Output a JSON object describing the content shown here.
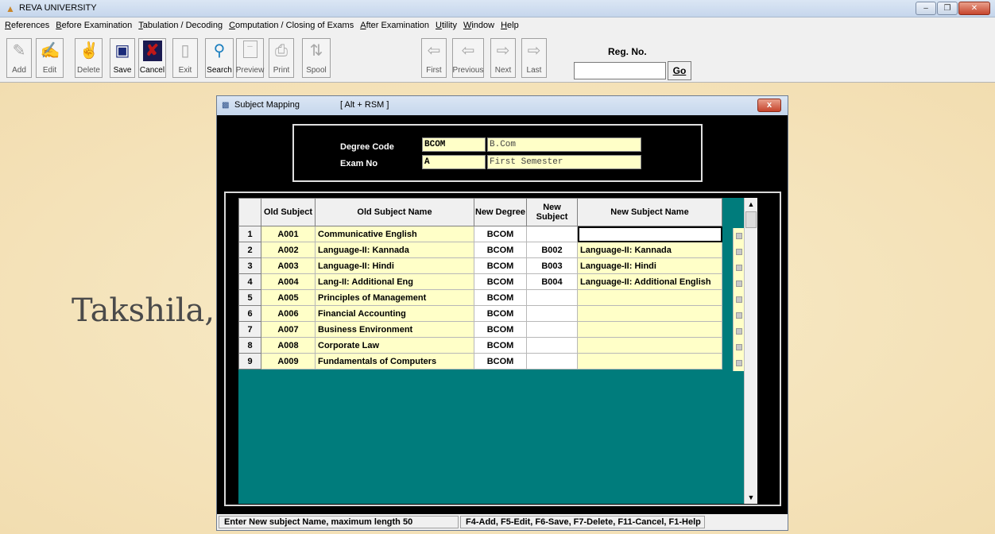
{
  "app": {
    "title": "REVA UNIVERSITY"
  },
  "menu": [
    "References",
    "Before Examination",
    "Tabulation / Decoding",
    "Computation / Closing of Exams",
    "After Examination",
    "Utility",
    "Window",
    "Help"
  ],
  "toolbar": {
    "buttons": [
      {
        "label": "Add",
        "icon": "add-record-icon"
      },
      {
        "label": "Edit",
        "icon": "edit-icon"
      },
      {
        "label": "Delete",
        "icon": "delete-icon"
      },
      {
        "label": "Save",
        "icon": "floppy-disk-icon"
      },
      {
        "label": "Cancel",
        "icon": "cancel-x-icon"
      },
      {
        "label": "Exit",
        "icon": "exit-door-icon"
      },
      {
        "label": "Search",
        "icon": "magnifier-icon"
      },
      {
        "label": "Preview",
        "icon": "document-preview-icon"
      },
      {
        "label": "Print",
        "icon": "printer-icon"
      },
      {
        "label": "Spool",
        "icon": "spool-icon"
      },
      {
        "label": "First",
        "icon": "first-arrow-icon"
      },
      {
        "label": "Previous",
        "icon": "previous-arrow-icon"
      },
      {
        "label": "Next",
        "icon": "next-arrow-icon"
      },
      {
        "label": "Last",
        "icon": "last-arrow-icon"
      }
    ],
    "reg_label": "Reg. No.",
    "reg_value": "",
    "go_label": "Go"
  },
  "backdrop": {
    "text": "Takshila, U"
  },
  "child": {
    "title": "Subject Mapping",
    "hotkey": "[ Alt + RSM ]",
    "close": "x",
    "degree_code_label": "Degree Code",
    "degree_code": "BCOM",
    "degree_name": "B.Com",
    "exam_no_label": "Exam No",
    "exam_no": "A",
    "exam_name": "First Semester"
  },
  "grid": {
    "headers": [
      "Old Subject",
      "Old Subject Name",
      "New Degree",
      "New Subject",
      "New Subject Name"
    ],
    "rows": [
      {
        "n": "1",
        "old": "A001",
        "old_name": "Communicative English",
        "new_degree": "BCOM",
        "new_subject": "",
        "new_name": ""
      },
      {
        "n": "2",
        "old": "A002",
        "old_name": "Language-II: Kannada",
        "new_degree": "BCOM",
        "new_subject": "B002",
        "new_name": "Language-II: Kannada"
      },
      {
        "n": "3",
        "old": "A003",
        "old_name": "Language-II: Hindi",
        "new_degree": "BCOM",
        "new_subject": "B003",
        "new_name": "Language-II: Hindi"
      },
      {
        "n": "4",
        "old": "A004",
        "old_name": "Lang-II: Additional Eng",
        "new_degree": "BCOM",
        "new_subject": "B004",
        "new_name": "Language-II: Additional English"
      },
      {
        "n": "5",
        "old": "A005",
        "old_name": "Principles of Management",
        "new_degree": "BCOM",
        "new_subject": "",
        "new_name": ""
      },
      {
        "n": "6",
        "old": "A006",
        "old_name": "Financial Accounting",
        "new_degree": "BCOM",
        "new_subject": "",
        "new_name": ""
      },
      {
        "n": "7",
        "old": "A007",
        "old_name": "Business Environment",
        "new_degree": "BCOM",
        "new_subject": "",
        "new_name": ""
      },
      {
        "n": "8",
        "old": "A008",
        "old_name": "Corporate Law",
        "new_degree": "BCOM",
        "new_subject": "",
        "new_name": ""
      },
      {
        "n": "9",
        "old": "A009",
        "old_name": "Fundamentals of Computers",
        "new_degree": "BCOM",
        "new_subject": "",
        "new_name": ""
      }
    ]
  },
  "status": {
    "left": "Enter New subject Name, maximum length 50",
    "right": "F4-Add, F5-Edit, F6-Save, F7-Delete, F11-Cancel, F1-Help"
  },
  "colors": {
    "grid_background": "#007c7c",
    "cell_yellow": "#ffffc8",
    "desktop": "#f5e4bb"
  }
}
